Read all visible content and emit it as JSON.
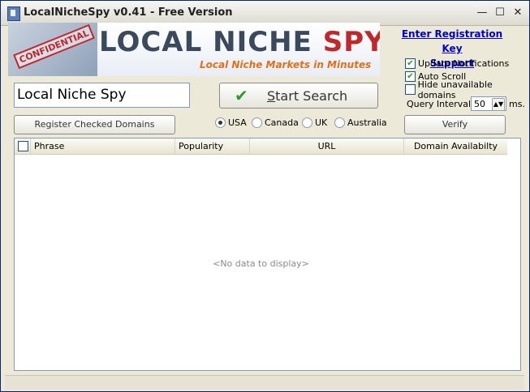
{
  "window": {
    "title": "LocalNicheSpy v0.41 - Free Version"
  },
  "banner": {
    "stamp": "CONFIDENTIAL",
    "logo_left": "LOCAL NICHE ",
    "logo_right": "SPY",
    "tagline": "Local Niche Markets in Minutes"
  },
  "registration": {
    "line1": "Enter Registration Key",
    "line2": "Support"
  },
  "options": {
    "update_notifications": {
      "label": "Update Notifications",
      "checked": true
    },
    "auto_scroll": {
      "label": "Auto Scroll",
      "checked": true
    },
    "hide_unavailable": {
      "label": "Hide unavailable domains",
      "checked": false
    },
    "query_interval_label": "Query Interval",
    "query_interval_value": "50",
    "query_interval_unit": "ms."
  },
  "search": {
    "value": "Local Niche Spy"
  },
  "buttons": {
    "start_search_u": "S",
    "start_search_rest": "tart Search",
    "register_checked": "Register Checked Domains",
    "verify": "Verify"
  },
  "countries": [
    {
      "label": "USA",
      "selected": true
    },
    {
      "label": "Canada",
      "selected": false
    },
    {
      "label": "UK",
      "selected": false
    },
    {
      "label": "Australia",
      "selected": false
    }
  ],
  "grid": {
    "columns": [
      "Phrase",
      "Popularity",
      "URL",
      "Domain Availabilty"
    ],
    "empty_text": "<No data to display>"
  },
  "colors": {
    "accent": "#c0282c",
    "tagline": "#e0701a",
    "link": "#0000cc"
  }
}
